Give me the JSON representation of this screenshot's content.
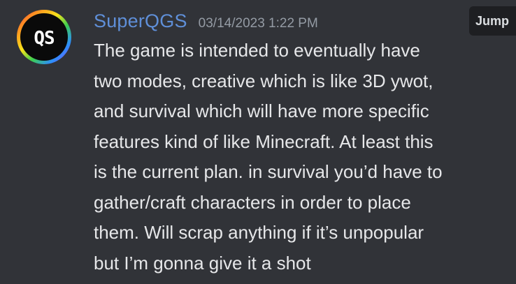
{
  "message": {
    "username": "SuperQGS",
    "timestamp": "03/14/2023 1:22 PM",
    "avatar": {
      "text": "QS",
      "icon": "qs-logo-avatar",
      "ring": "rainbow"
    },
    "lines": [
      "The game is intended to eventually have",
      "two modes, creative which is like 3D ywot,",
      "and survival which will have more specific",
      "features kind of like Minecraft. At least this",
      "is the current plan. in survival you’d have to",
      "gather/craft characters in order to place",
      "them. Will scrap anything if it’s unpopular",
      "but I’m gonna give it a shot"
    ]
  },
  "jump_button": {
    "label": "Jump"
  },
  "colors": {
    "background": "#313338",
    "username": "#5f8fd8",
    "timestamp": "#949ba4",
    "text": "#e6e7e9",
    "jump_bg": "#1e1f22"
  }
}
